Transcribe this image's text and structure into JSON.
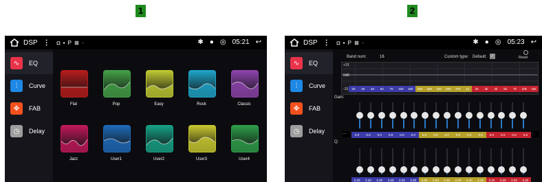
{
  "labels": {
    "left_number": "1",
    "right_number": "2"
  },
  "status_left": {
    "title": "DSP",
    "menu": "⋮",
    "indicators": "◘ ▪ P ⊠ ·",
    "time": "05:21"
  },
  "status_right": {
    "title": "DSP",
    "menu": "⋮",
    "indicators": "◘ ▪ P ⊠ ·",
    "time": "05:23"
  },
  "sidebar": [
    {
      "label": "EQ",
      "icon": "eq-wave-icon",
      "color": "#e8334a"
    },
    {
      "label": "Curve",
      "icon": "sliders-icon",
      "color": "#1e88e5"
    },
    {
      "label": "FAB",
      "icon": "balance-icon",
      "color": "#f4511e"
    },
    {
      "label": "Delay",
      "icon": "clock-icon",
      "color": "#9e9e9e"
    }
  ],
  "presets": [
    {
      "label": "Flat",
      "color": "#b71c1c"
    },
    {
      "label": "Pop",
      "color": "#43a047"
    },
    {
      "label": "Easy",
      "color": "#c0ca33"
    },
    {
      "label": "Rock",
      "color": "#1fa4c9"
    },
    {
      "label": "Classic",
      "color": "#8e44ad"
    },
    {
      "label": "Jazz",
      "color": "#c2185b"
    },
    {
      "label": "User1",
      "color": "#1e6ab8"
    },
    {
      "label": "User2",
      "color": "#16a085"
    },
    {
      "label": "User3",
      "color": "#c8c830"
    },
    {
      "label": "User4",
      "color": "#2e9e4a"
    }
  ],
  "eq": {
    "band_num_label": "Band num:",
    "band_num": "16",
    "custom_type_label": "Custom type:",
    "custom_type_value": "Default:",
    "reset_label": "Reset",
    "scale": [
      "+15",
      "0dB",
      "-15"
    ],
    "frequencies": [
      "20",
      "30",
      "40",
      "50",
      "70",
      "100",
      "150",
      "200",
      "300",
      "400",
      "500",
      "700",
      "1k",
      "2k",
      "3k",
      "4k",
      "5k",
      "7k",
      "10k",
      "16k"
    ],
    "gain_label": "Gain:",
    "gain_values": [
      "0.0",
      "0.0",
      "0.0",
      "0.0",
      "0.0",
      "0.0",
      "0.0",
      "0.0",
      "0.0",
      "0.0",
      "0.0",
      "0.0",
      "0.0",
      "0.0",
      "0.0",
      "0.0"
    ],
    "q_label": "Q:",
    "q_values": [
      "2.20",
      "2.20",
      "2.20",
      "2.20",
      "2.20",
      "2.20",
      "2.20",
      "2.20",
      "2.20",
      "2.20",
      "2.20",
      "2.20",
      "2.20",
      "2.20",
      "2.20",
      "2.20"
    ],
    "band_colors": [
      "#3b3ba8",
      "#3b3ba8",
      "#3b3ba8",
      "#3b3ba8",
      "#3b3ba8",
      "#3b3ba8",
      "#b5a12a",
      "#b5a12a",
      "#b5a12a",
      "#b5a12a",
      "#b5a12a",
      "#b5a12a",
      "#c4232f",
      "#c4232f",
      "#c4232f",
      "#c4232f"
    ]
  }
}
